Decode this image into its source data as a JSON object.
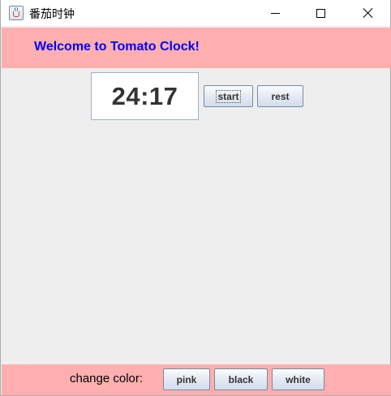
{
  "window": {
    "title": "番茄时钟",
    "app_icon": "java-cup-icon",
    "controls": {
      "minimize_icon": "minimize-icon",
      "maximize_icon": "maximize-icon",
      "close_icon": "close-icon"
    }
  },
  "header": {
    "welcome_text": "Welcome to Tomato Clock!",
    "background_color": "#ffafaf",
    "text_color": "#0000ff"
  },
  "timer": {
    "display": "24:17",
    "start_label": "start",
    "rest_label": "rest"
  },
  "footer": {
    "change_color_label": "change color:",
    "buttons": [
      {
        "label": "pink"
      },
      {
        "label": "black"
      },
      {
        "label": "white"
      }
    ],
    "background_color": "#ffafaf"
  },
  "content_background": "#eeeeee"
}
